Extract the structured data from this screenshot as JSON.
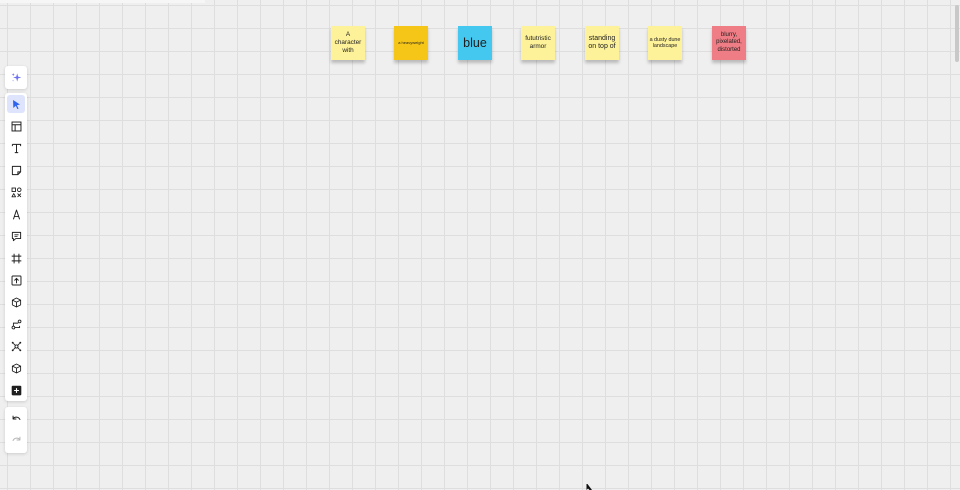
{
  "board": {
    "background": "#efefef",
    "grid_line_color": "#dedede"
  },
  "stickies": [
    {
      "text": "A character with",
      "color": "#fdf19a"
    },
    {
      "text": "a heavyweight",
      "color": "#f5c518"
    },
    {
      "text": "blue",
      "color": "#44c8ef"
    },
    {
      "text": "fututristic armor",
      "color": "#fdf19a"
    },
    {
      "text": "standing on top of",
      "color": "#fdf19a"
    },
    {
      "text": "a dusty dune landscape",
      "color": "#fdf19a"
    },
    {
      "text": "blurry, pixelated, distorted",
      "color": "#ef7d85"
    }
  ],
  "toolbar": {
    "ai_tool": {
      "icon": "sparkle-icon",
      "accent": "#6c70f0"
    },
    "tools": [
      {
        "icon": "pointer-icon",
        "active": true
      },
      {
        "icon": "template-icon"
      },
      {
        "icon": "text-icon"
      },
      {
        "icon": "sticky-note-icon"
      },
      {
        "icon": "shapes-icon"
      },
      {
        "icon": "pen-icon"
      },
      {
        "icon": "comment-icon"
      },
      {
        "icon": "frame-icon"
      },
      {
        "icon": "upload-icon"
      },
      {
        "icon": "3d-cube-icon"
      },
      {
        "icon": "connector-icon"
      },
      {
        "icon": "mind-map-icon"
      },
      {
        "icon": "cube-icon"
      },
      {
        "icon": "more-apps-icon"
      }
    ],
    "history": [
      {
        "icon": "undo-icon",
        "enabled": true
      },
      {
        "icon": "redo-icon",
        "enabled": false
      }
    ],
    "active_color": "#2e63f0",
    "icon_color": "#1f1f1f",
    "disabled_color": "#b4b4b4"
  }
}
